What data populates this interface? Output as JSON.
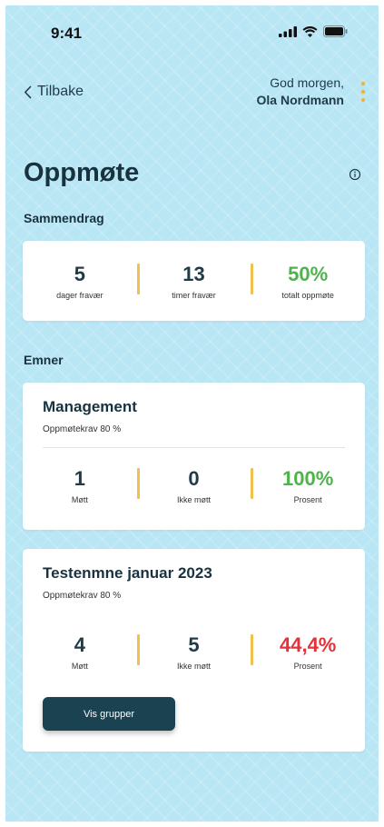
{
  "status_bar": {
    "time": "9:41"
  },
  "header": {
    "back_label": "Tilbake",
    "greeting": "God morgen,",
    "user_name": "Ola Nordmann"
  },
  "page": {
    "title": "Oppmøte"
  },
  "summary": {
    "section_label": "Sammendrag",
    "stats": [
      {
        "value": "5",
        "label": "dager fravær"
      },
      {
        "value": "13",
        "label": "timer fravær"
      },
      {
        "value": "50%",
        "label": "totalt oppmøte"
      }
    ]
  },
  "courses": {
    "section_label": "Emner",
    "items": [
      {
        "title": "Management",
        "requirement": "Oppmøtekrav 80 %",
        "stats": [
          {
            "value": "1",
            "label": "Møtt"
          },
          {
            "value": "0",
            "label": "Ikke møtt"
          },
          {
            "value": "100%",
            "label": "Prosent"
          }
        ]
      },
      {
        "title": "Testenmne januar 2023",
        "requirement": "Oppmøtekrav 80 %",
        "stats": [
          {
            "value": "4",
            "label": "Møtt"
          },
          {
            "value": "5",
            "label": "Ikke møtt"
          },
          {
            "value": "44,4%",
            "label": "Prosent"
          }
        ],
        "button_label": "Vis grupper"
      }
    ]
  },
  "colors": {
    "background": "#b8e6f4",
    "accent_divider": "#f0c050",
    "good": "#4db34a",
    "bad": "#e5323a",
    "primary_button": "#1b4250",
    "menu_dots": "#f0b43c"
  }
}
